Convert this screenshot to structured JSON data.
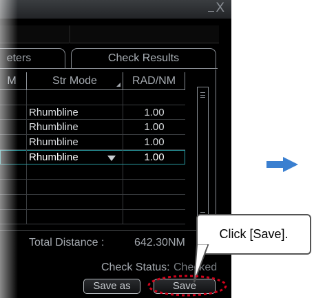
{
  "window": {
    "close_glyph": "X"
  },
  "tabs": [
    {
      "label": "eters"
    },
    {
      "label": "Check Results"
    }
  ],
  "table": {
    "headers": [
      "M",
      "Str Mode",
      "RAD/NM"
    ],
    "rows": [
      {
        "col0": "",
        "str_mode": "",
        "rad_nm": ""
      },
      {
        "col0": "",
        "str_mode": "Rhumbline",
        "rad_nm": "1.00"
      },
      {
        "col0": "",
        "str_mode": "Rhumbline",
        "rad_nm": "1.00"
      },
      {
        "col0": "",
        "str_mode": "Rhumbline",
        "rad_nm": "1.00"
      },
      {
        "col0": "",
        "str_mode": "Rhumbline",
        "rad_nm": "1.00",
        "selected": true
      },
      {
        "col0": "",
        "str_mode": "",
        "rad_nm": ""
      },
      {
        "col0": "",
        "str_mode": "",
        "rad_nm": ""
      },
      {
        "col0": "",
        "str_mode": "",
        "rad_nm": ""
      },
      {
        "col0": "",
        "str_mode": "",
        "rad_nm": ""
      }
    ]
  },
  "summary": {
    "total_distance_label": "Total Distance :",
    "total_distance_value": "642.30NM",
    "check_status_label": "Check Status:",
    "check_status_value": "Checked"
  },
  "buttons": {
    "save_as": "Save as",
    "save": "Save"
  },
  "callout": {
    "text": "Click [Save]."
  },
  "colors": {
    "accent": "#2a9aa0",
    "arrow": "#3a7fd0",
    "highlight": "#d0021b"
  }
}
